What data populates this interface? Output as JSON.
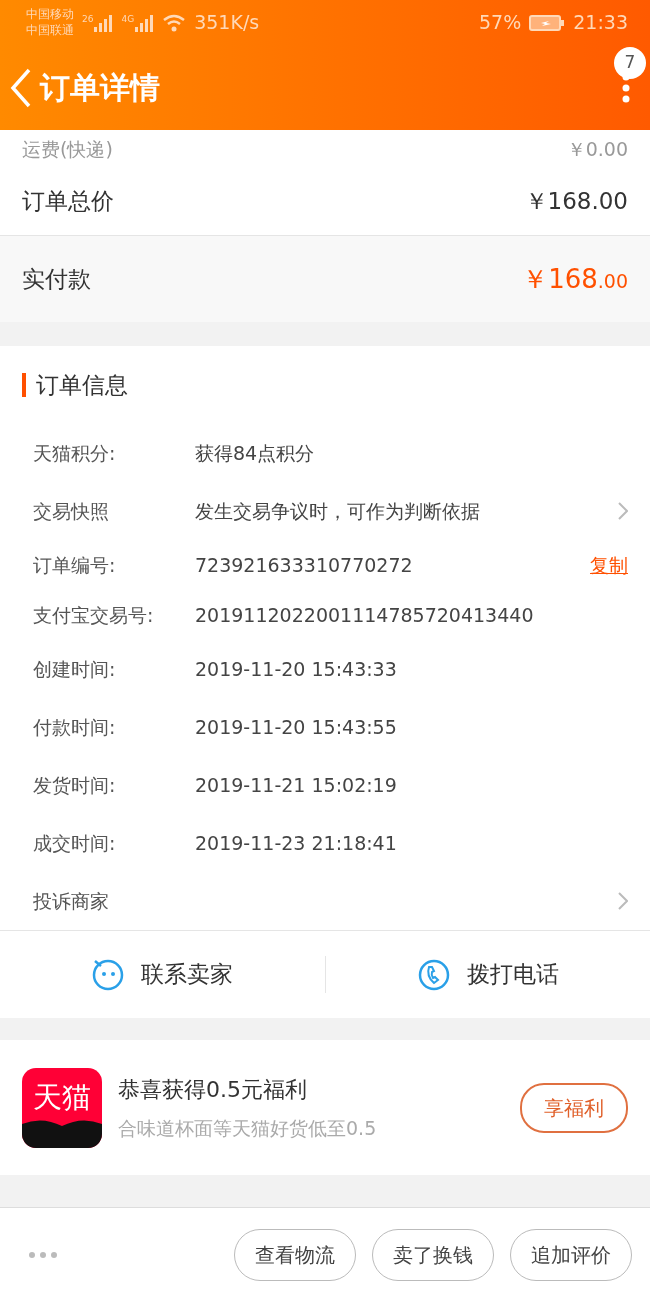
{
  "status_bar": {
    "carriers": [
      "中国移动",
      "中国联通"
    ],
    "network_1": "26",
    "network_2": "4G",
    "speed": "351K/s",
    "battery": "57%",
    "time": "21:33"
  },
  "header": {
    "title": "订单详情",
    "badge": "7"
  },
  "fees": [
    {
      "label": "运费(快递)",
      "value": "￥0.00",
      "kind": "minor"
    },
    {
      "label": "订单总价",
      "value": "￥168.00",
      "kind": "total"
    }
  ],
  "paid": {
    "label": "实付款",
    "amount_main": "￥168",
    "amount_cents": ".00"
  },
  "order_info": {
    "title": "订单信息",
    "rows": [
      {
        "label": "天猫积分:",
        "value": "获得84点积分"
      },
      {
        "label": "交易快照",
        "value": "发生交易争议时，可作为判断依据",
        "kind": "link"
      },
      {
        "label": "订单编号:",
        "value": "723921633310770272",
        "action": "复制"
      },
      {
        "label": "支付宝交易号:",
        "value": "2019112022001114785720413440"
      },
      {
        "label": "创建时间:",
        "value": "2019-11-20 15:43:33"
      },
      {
        "label": "付款时间:",
        "value": "2019-11-20 15:43:55"
      },
      {
        "label": "发货时间:",
        "value": "2019-11-21 15:02:19"
      },
      {
        "label": "成交时间:",
        "value": "2019-11-23 21:18:41"
      },
      {
        "label": "投诉商家",
        "kind": "link"
      }
    ]
  },
  "contact": [
    {
      "label": "联系卖家",
      "kind": "chat"
    },
    {
      "label": "拨打电话",
      "kind": "phone"
    }
  ],
  "promo": {
    "logo": "天猫",
    "title": "恭喜获得0.5元福利",
    "subtitle": "合味道杯面等天猫好货低至0.5",
    "button": "享福利"
  },
  "bottom_buttons": [
    "查看物流",
    "卖了换钱",
    "追加评价"
  ]
}
